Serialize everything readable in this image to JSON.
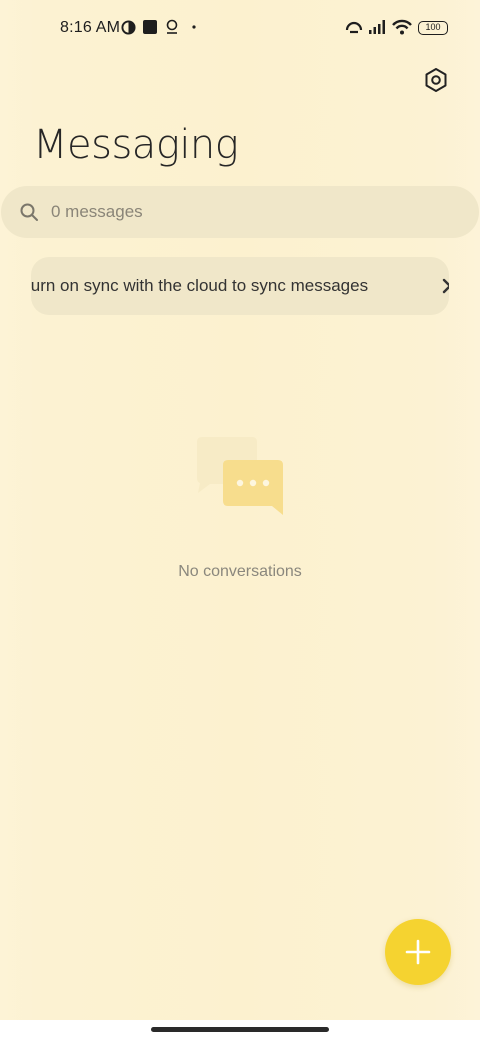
{
  "status_bar": {
    "time": "8:16 AM",
    "battery": "100"
  },
  "header": {
    "title": "Messaging",
    "settings_icon": "settings-hexagon-icon"
  },
  "search": {
    "placeholder": "0 messages",
    "icon": "search-icon"
  },
  "sync_banner": {
    "text": "Turn on sync with the cloud to sync messages",
    "icon": "chevron-right-icon"
  },
  "empty_state": {
    "icon": "chat-bubbles-icon",
    "label": "No conversations"
  },
  "fab": {
    "icon": "plus-icon",
    "color": "#f5d330"
  },
  "colors": {
    "background": "#fcf1cf",
    "surface": "#f0e7c9",
    "accent": "#f5d330"
  }
}
